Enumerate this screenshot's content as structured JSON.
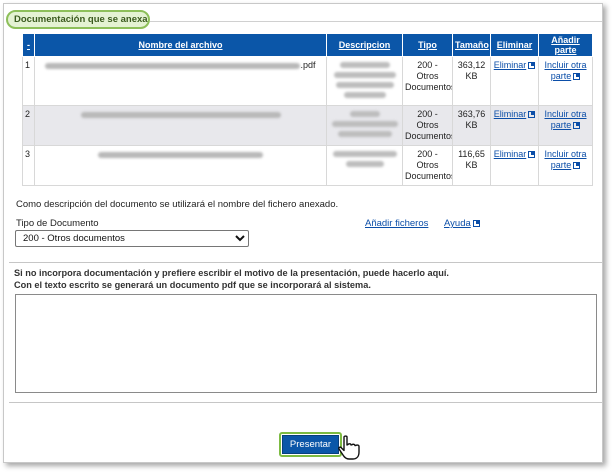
{
  "section": {
    "title": "Documentación que se anexa"
  },
  "table": {
    "headers": {
      "index": "-",
      "name": "Nombre del archivo",
      "description": "Descripcion",
      "type": "Tipo",
      "size": "Tamaño",
      "delete": "Eliminar",
      "add_part": "Añadir parte"
    },
    "rows": [
      {
        "index": "1",
        "name_suffix": ".pdf",
        "type": "200 - Otros Documentos",
        "size": "363,12 KB",
        "delete": "Eliminar",
        "include": "Incluir otra parte"
      },
      {
        "index": "2",
        "name_suffix": "",
        "type": "200 - Otros Documentos",
        "size": "363,76 KB",
        "delete": "Eliminar",
        "include": "Incluir otra parte"
      },
      {
        "index": "3",
        "name_suffix": "",
        "type": "200 - Otros Documentos",
        "size": "116,65 KB",
        "delete": "Eliminar",
        "include": "Incluir otra parte"
      }
    ]
  },
  "note": "Como descripción del documento se utilizará el nombre del fichero anexado.",
  "doc_type": {
    "label": "Tipo de Documento",
    "selected": "200 - Otros documentos"
  },
  "links": {
    "add_files": "Añadir ficheros",
    "help": "Ayuda"
  },
  "instructions": {
    "line1": "Si no incorpora documentación y prefiere escribir el motivo de la presentación, puede hacerlo aquí.",
    "line2": "Con el texto escrito se generará un documento pdf que se incorporará al sistema."
  },
  "motivo": {
    "value": ""
  },
  "submit": {
    "label": "Presentar"
  },
  "icons": {
    "external": "external-link-icon",
    "cursor": "hand-pointer-icon"
  },
  "colors": {
    "header_blue": "#0b56a8",
    "accent_green": "#8dbf5a",
    "link_blue": "#0b4ea8"
  }
}
